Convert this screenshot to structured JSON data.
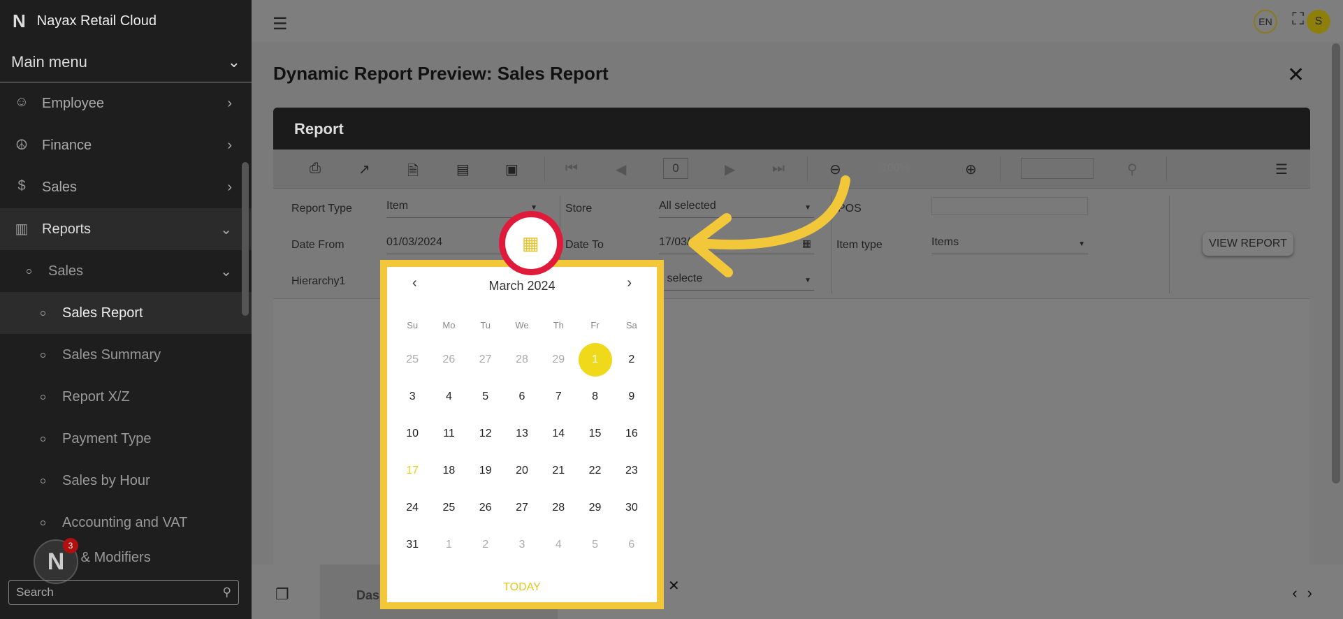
{
  "app": {
    "brand": "Nayax Retail Cloud",
    "logo": "N"
  },
  "sidebar": {
    "main_menu": "Main menu",
    "items": [
      {
        "label": "Employee",
        "icon": "person-icon"
      },
      {
        "label": "Finance",
        "icon": "hand-coin-icon"
      },
      {
        "label": "Sales",
        "icon": "dollar-doc-icon"
      },
      {
        "label": "Reports",
        "icon": "bar-chart-icon"
      }
    ],
    "sub_sales": "Sales",
    "sub_items": [
      {
        "label": "Sales Report"
      },
      {
        "label": "Sales Summary"
      },
      {
        "label": "Report X/Z"
      },
      {
        "label": "Payment Type"
      },
      {
        "label": "Sales by Hour"
      },
      {
        "label": "Accounting and VAT"
      },
      {
        "label": "es & Modifiers"
      }
    ],
    "search_placeholder": "Search",
    "notif_count": "3"
  },
  "topbar": {
    "lang": "EN",
    "avatar": "S"
  },
  "page": {
    "title": "Dynamic Report Preview: Sales Report",
    "panel_title": "Report"
  },
  "toolbar": {
    "page_number": "0",
    "zoom": "100%"
  },
  "params": {
    "report_type_label": "Report Type",
    "report_type_value": "Item",
    "store_label": "Store",
    "store_value": "All selected",
    "pos_label": "POS",
    "date_from_label": "Date From",
    "date_from_value": "01/03/2024",
    "date_to_label": "Date To",
    "date_to_value": "17/03/2",
    "item_type_label": "Item type",
    "item_type_value": "Items",
    "hierarchy_label": "Hierarchy1",
    "hierarchy_value": "ll selecte",
    "view_report": "VIEW REPORT"
  },
  "bottom": {
    "tab_label": "Das"
  },
  "calendar": {
    "month_label": "March 2024",
    "weekdays": [
      "Su",
      "Mo",
      "Tu",
      "We",
      "Th",
      "Fr",
      "Sa"
    ],
    "days": [
      {
        "n": "25",
        "m": true
      },
      {
        "n": "26",
        "m": true
      },
      {
        "n": "27",
        "m": true
      },
      {
        "n": "28",
        "m": true
      },
      {
        "n": "29",
        "m": true
      },
      {
        "n": "1",
        "sel": true
      },
      {
        "n": "2"
      },
      {
        "n": "3"
      },
      {
        "n": "4"
      },
      {
        "n": "5"
      },
      {
        "n": "6"
      },
      {
        "n": "7"
      },
      {
        "n": "8"
      },
      {
        "n": "9"
      },
      {
        "n": "10"
      },
      {
        "n": "11"
      },
      {
        "n": "12"
      },
      {
        "n": "13"
      },
      {
        "n": "14"
      },
      {
        "n": "15"
      },
      {
        "n": "16"
      },
      {
        "n": "17",
        "today": true
      },
      {
        "n": "18"
      },
      {
        "n": "19"
      },
      {
        "n": "20"
      },
      {
        "n": "21"
      },
      {
        "n": "22"
      },
      {
        "n": "23"
      },
      {
        "n": "24"
      },
      {
        "n": "25"
      },
      {
        "n": "26"
      },
      {
        "n": "27"
      },
      {
        "n": "28"
      },
      {
        "n": "29"
      },
      {
        "n": "30"
      },
      {
        "n": "31"
      },
      {
        "n": "1",
        "m": true
      },
      {
        "n": "2",
        "m": true
      },
      {
        "n": "3",
        "m": true
      },
      {
        "n": "4",
        "m": true
      },
      {
        "n": "5",
        "m": true
      },
      {
        "n": "6",
        "m": true
      }
    ],
    "today_label": "TODAY"
  },
  "colors": {
    "accent": "#f2c83a",
    "ring": "#e01a3a",
    "selected": "#f0d81a"
  }
}
